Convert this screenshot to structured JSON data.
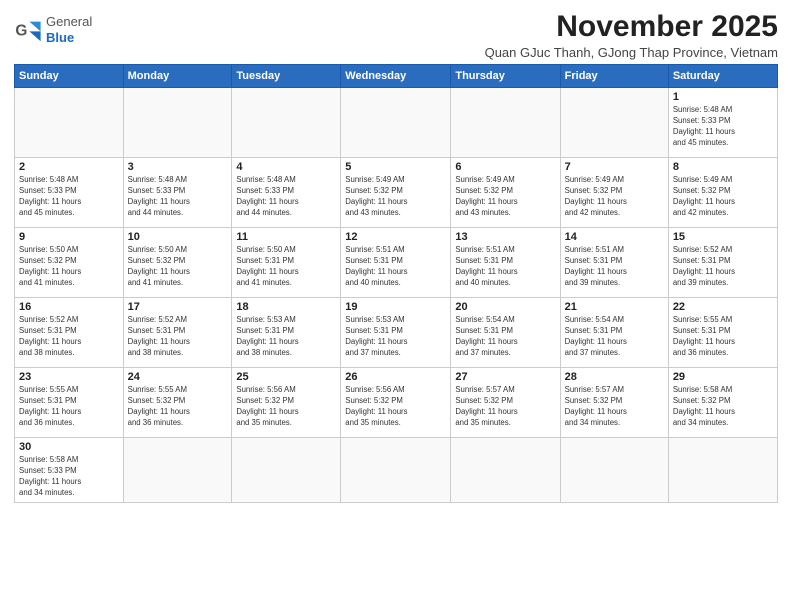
{
  "header": {
    "logo_general": "General",
    "logo_blue": "Blue",
    "month_title": "November 2025",
    "subtitle": "Quan GJuc Thanh, GJong Thap Province, Vietnam"
  },
  "weekdays": [
    "Sunday",
    "Monday",
    "Tuesday",
    "Wednesday",
    "Thursday",
    "Friday",
    "Saturday"
  ],
  "weeks": [
    [
      {
        "day": "",
        "info": ""
      },
      {
        "day": "",
        "info": ""
      },
      {
        "day": "",
        "info": ""
      },
      {
        "day": "",
        "info": ""
      },
      {
        "day": "",
        "info": ""
      },
      {
        "day": "",
        "info": ""
      },
      {
        "day": "1",
        "info": "Sunrise: 5:48 AM\nSunset: 5:33 PM\nDaylight: 11 hours\nand 45 minutes."
      }
    ],
    [
      {
        "day": "2",
        "info": "Sunrise: 5:48 AM\nSunset: 5:33 PM\nDaylight: 11 hours\nand 45 minutes."
      },
      {
        "day": "3",
        "info": "Sunrise: 5:48 AM\nSunset: 5:33 PM\nDaylight: 11 hours\nand 44 minutes."
      },
      {
        "day": "4",
        "info": "Sunrise: 5:48 AM\nSunset: 5:33 PM\nDaylight: 11 hours\nand 44 minutes."
      },
      {
        "day": "5",
        "info": "Sunrise: 5:49 AM\nSunset: 5:32 PM\nDaylight: 11 hours\nand 43 minutes."
      },
      {
        "day": "6",
        "info": "Sunrise: 5:49 AM\nSunset: 5:32 PM\nDaylight: 11 hours\nand 43 minutes."
      },
      {
        "day": "7",
        "info": "Sunrise: 5:49 AM\nSunset: 5:32 PM\nDaylight: 11 hours\nand 42 minutes."
      },
      {
        "day": "8",
        "info": "Sunrise: 5:49 AM\nSunset: 5:32 PM\nDaylight: 11 hours\nand 42 minutes."
      }
    ],
    [
      {
        "day": "9",
        "info": "Sunrise: 5:50 AM\nSunset: 5:32 PM\nDaylight: 11 hours\nand 41 minutes."
      },
      {
        "day": "10",
        "info": "Sunrise: 5:50 AM\nSunset: 5:32 PM\nDaylight: 11 hours\nand 41 minutes."
      },
      {
        "day": "11",
        "info": "Sunrise: 5:50 AM\nSunset: 5:31 PM\nDaylight: 11 hours\nand 41 minutes."
      },
      {
        "day": "12",
        "info": "Sunrise: 5:51 AM\nSunset: 5:31 PM\nDaylight: 11 hours\nand 40 minutes."
      },
      {
        "day": "13",
        "info": "Sunrise: 5:51 AM\nSunset: 5:31 PM\nDaylight: 11 hours\nand 40 minutes."
      },
      {
        "day": "14",
        "info": "Sunrise: 5:51 AM\nSunset: 5:31 PM\nDaylight: 11 hours\nand 39 minutes."
      },
      {
        "day": "15",
        "info": "Sunrise: 5:52 AM\nSunset: 5:31 PM\nDaylight: 11 hours\nand 39 minutes."
      }
    ],
    [
      {
        "day": "16",
        "info": "Sunrise: 5:52 AM\nSunset: 5:31 PM\nDaylight: 11 hours\nand 38 minutes."
      },
      {
        "day": "17",
        "info": "Sunrise: 5:52 AM\nSunset: 5:31 PM\nDaylight: 11 hours\nand 38 minutes."
      },
      {
        "day": "18",
        "info": "Sunrise: 5:53 AM\nSunset: 5:31 PM\nDaylight: 11 hours\nand 38 minutes."
      },
      {
        "day": "19",
        "info": "Sunrise: 5:53 AM\nSunset: 5:31 PM\nDaylight: 11 hours\nand 37 minutes."
      },
      {
        "day": "20",
        "info": "Sunrise: 5:54 AM\nSunset: 5:31 PM\nDaylight: 11 hours\nand 37 minutes."
      },
      {
        "day": "21",
        "info": "Sunrise: 5:54 AM\nSunset: 5:31 PM\nDaylight: 11 hours\nand 37 minutes."
      },
      {
        "day": "22",
        "info": "Sunrise: 5:55 AM\nSunset: 5:31 PM\nDaylight: 11 hours\nand 36 minutes."
      }
    ],
    [
      {
        "day": "23",
        "info": "Sunrise: 5:55 AM\nSunset: 5:31 PM\nDaylight: 11 hours\nand 36 minutes."
      },
      {
        "day": "24",
        "info": "Sunrise: 5:55 AM\nSunset: 5:32 PM\nDaylight: 11 hours\nand 36 minutes."
      },
      {
        "day": "25",
        "info": "Sunrise: 5:56 AM\nSunset: 5:32 PM\nDaylight: 11 hours\nand 35 minutes."
      },
      {
        "day": "26",
        "info": "Sunrise: 5:56 AM\nSunset: 5:32 PM\nDaylight: 11 hours\nand 35 minutes."
      },
      {
        "day": "27",
        "info": "Sunrise: 5:57 AM\nSunset: 5:32 PM\nDaylight: 11 hours\nand 35 minutes."
      },
      {
        "day": "28",
        "info": "Sunrise: 5:57 AM\nSunset: 5:32 PM\nDaylight: 11 hours\nand 34 minutes."
      },
      {
        "day": "29",
        "info": "Sunrise: 5:58 AM\nSunset: 5:32 PM\nDaylight: 11 hours\nand 34 minutes."
      }
    ],
    [
      {
        "day": "30",
        "info": "Sunrise: 5:58 AM\nSunset: 5:33 PM\nDaylight: 11 hours\nand 34 minutes."
      },
      {
        "day": "",
        "info": ""
      },
      {
        "day": "",
        "info": ""
      },
      {
        "day": "",
        "info": ""
      },
      {
        "day": "",
        "info": ""
      },
      {
        "day": "",
        "info": ""
      },
      {
        "day": "",
        "info": ""
      }
    ]
  ]
}
